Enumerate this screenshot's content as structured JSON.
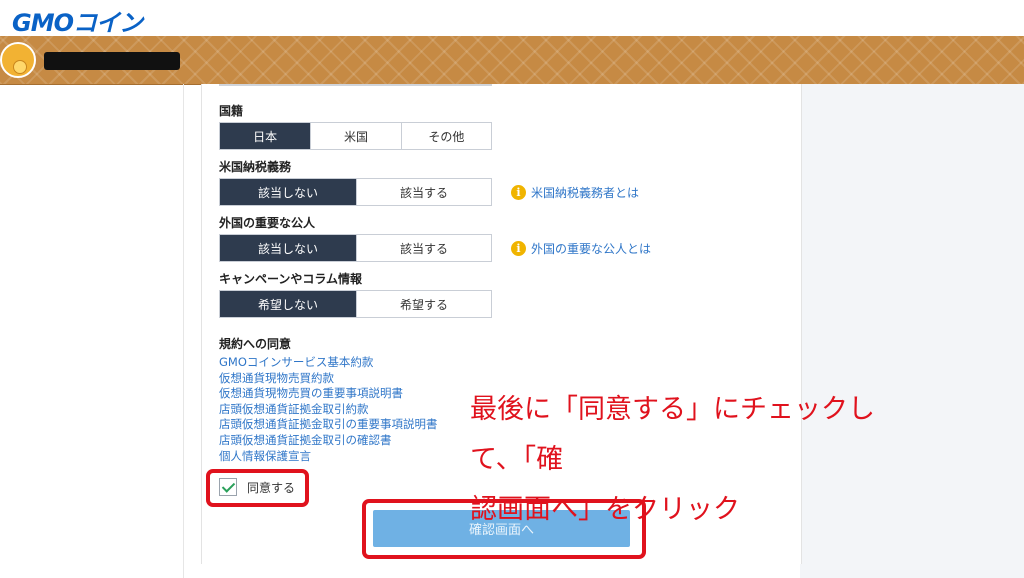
{
  "header": {
    "logo_text": "GMOコイン",
    "brand_color": "#0a62c6"
  },
  "form": {
    "nationality": {
      "title": "国籍",
      "options": [
        "日本",
        "米国",
        "その他"
      ],
      "selected": "日本"
    },
    "us_tax": {
      "title": "米国納税義務",
      "options": [
        "該当しない",
        "該当する"
      ],
      "selected": "該当しない",
      "info_link": "米国納税義務者とは"
    },
    "pep": {
      "title": "外国の重要な公人",
      "options": [
        "該当しない",
        "該当する"
      ],
      "selected": "該当しない",
      "info_link": "外国の重要な公人とは"
    },
    "campaign": {
      "title": "キャンペーンやコラム情報",
      "options": [
        "希望しない",
        "希望する"
      ],
      "selected": "希望しない"
    },
    "terms": {
      "title": "規約への同意",
      "links": [
        "GMOコインサービス基本約款",
        "仮想通貨現物売買約款",
        "仮想通貨現物売買の重要事項説明書",
        "店頭仮想通貨証拠金取引約款",
        "店頭仮想通貨証拠金取引の重要事項説明書",
        "店頭仮想通貨証拠金取引の確認書",
        "個人情報保護宣言"
      ]
    },
    "agree_label": "同意する",
    "agree_checked": true,
    "confirm_button": "確認画面へ"
  },
  "annotation": {
    "line1": "最後に「同意する」にチェックして、「確",
    "line2": "認画面へ」をクリック",
    "color": "#e0121d"
  },
  "icons": {
    "info": "info-icon",
    "check": "check-icon"
  }
}
